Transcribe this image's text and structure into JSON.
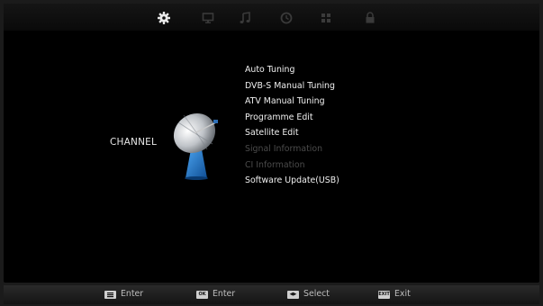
{
  "top_tabs": [
    {
      "icon": "gear-icon",
      "active": true
    },
    {
      "icon": "monitor-icon",
      "active": false
    },
    {
      "icon": "music-note-icon",
      "active": false
    },
    {
      "icon": "clock-icon",
      "active": false
    },
    {
      "icon": "grid-icon",
      "active": false
    },
    {
      "icon": "lock-icon",
      "active": false
    }
  ],
  "category": {
    "label": "CHANNEL",
    "icon": "satellite-dish-icon"
  },
  "menu": {
    "items": [
      {
        "label": "Auto Tuning",
        "enabled": true
      },
      {
        "label": "DVB-S Manual Tuning",
        "enabled": true
      },
      {
        "label": "ATV Manual Tuning",
        "enabled": true
      },
      {
        "label": "Programme Edit",
        "enabled": true
      },
      {
        "label": "Satellite Edit",
        "enabled": true
      },
      {
        "label": "Signal Information",
        "enabled": false
      },
      {
        "label": "CI Information",
        "enabled": false
      },
      {
        "label": "Software Update(USB)",
        "enabled": true
      }
    ]
  },
  "footer": {
    "hints": [
      {
        "key": "",
        "label": "Enter"
      },
      {
        "key": "OK",
        "label": "Enter"
      },
      {
        "key": "◀▶",
        "label": "Select"
      },
      {
        "key": "EXIT",
        "label": "Exit"
      }
    ]
  },
  "colors": {
    "text": "#f0f0f0",
    "disabled_text": "#4b4b4b",
    "active_icon": "#e8e8e8",
    "inactive_icon": "#3a3a3a",
    "dish_accent": "#2a7fd0"
  }
}
